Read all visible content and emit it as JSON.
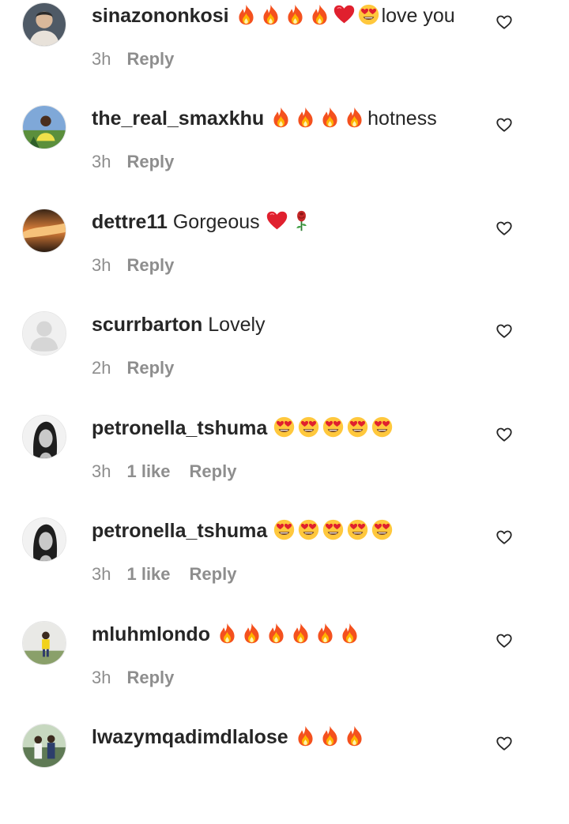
{
  "comments": [
    {
      "username": "sinazononkosi",
      "emojis_before": [
        "fire",
        "fire",
        "fire",
        "fire",
        "red-heart",
        "heart-eyes"
      ],
      "text": "love you",
      "time": "3h",
      "likes": "",
      "reply_label": "Reply",
      "avatar": "profile-photo"
    },
    {
      "username": "the_real_smaxkhu",
      "emojis_before": [
        "fire",
        "fire",
        "fire",
        "fire"
      ],
      "text": "hotness",
      "time": "3h",
      "likes": "",
      "reply_label": "Reply",
      "avatar": "profile-photo"
    },
    {
      "username": "dettre11",
      "emojis_before": [],
      "text": "Gorgeous",
      "emojis_after": [
        "red-heart",
        "rose"
      ],
      "time": "3h",
      "likes": "",
      "reply_label": "Reply",
      "avatar": "profile-photo"
    },
    {
      "username": "scurrbarton",
      "emojis_before": [],
      "text": "Lovely",
      "time": "2h",
      "likes": "",
      "reply_label": "Reply",
      "avatar": "default-avatar"
    },
    {
      "username": "petronella_tshuma",
      "emojis_before": [
        "heart-eyes",
        "heart-eyes",
        "heart-eyes",
        "heart-eyes",
        "heart-eyes"
      ],
      "text": "",
      "time": "3h",
      "likes": "1 like",
      "reply_label": "Reply",
      "avatar": "profile-photo"
    },
    {
      "username": "petronella_tshuma",
      "emojis_before": [
        "heart-eyes",
        "heart-eyes",
        "heart-eyes",
        "heart-eyes",
        "heart-eyes"
      ],
      "text": "",
      "time": "3h",
      "likes": "1 like",
      "reply_label": "Reply",
      "avatar": "profile-photo"
    },
    {
      "username": "mluhmlondo",
      "emojis_before": [
        "fire",
        "fire",
        "fire",
        "fire",
        "fire",
        "fire"
      ],
      "text": "",
      "time": "3h",
      "likes": "",
      "reply_label": "Reply",
      "avatar": "profile-photo"
    },
    {
      "username": "lwazymqadimdlalose",
      "emojis_before": [
        "fire",
        "fire",
        "fire"
      ],
      "text": "",
      "time": "",
      "likes": "",
      "reply_label": "",
      "avatar": "profile-photo"
    }
  ],
  "colors": {
    "text": "#262626",
    "secondary": "#8e8e8e",
    "fire": "#f4511e",
    "heart": "#e0202e",
    "emoji_face": "#ffc83d"
  }
}
